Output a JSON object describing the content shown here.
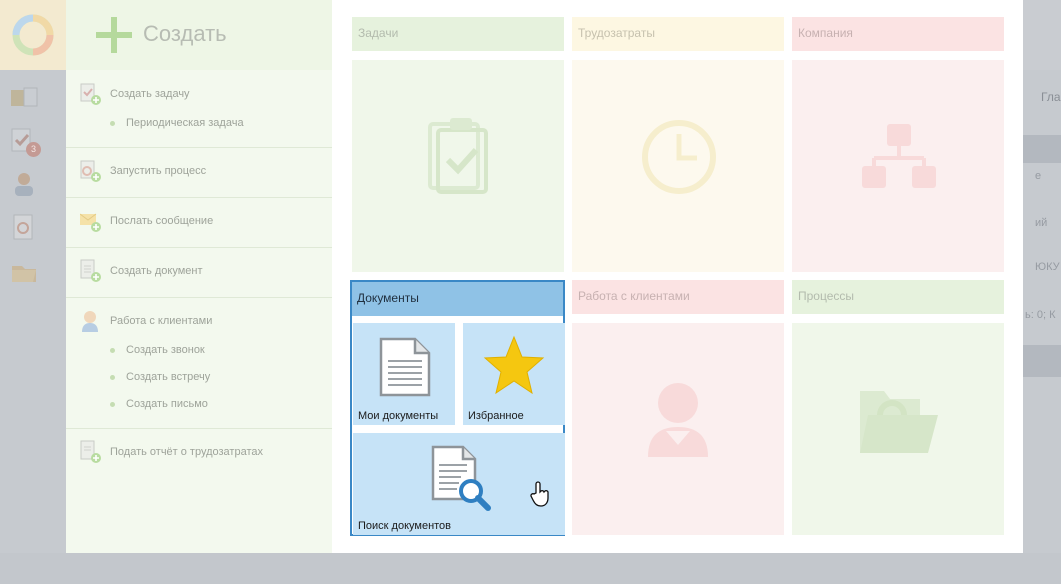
{
  "create": {
    "title": "Создать",
    "items": [
      {
        "label": "Создать задачу",
        "icon": "task-add-icon",
        "subitems": [
          {
            "label": "Периодическая задача"
          }
        ]
      },
      {
        "label": "Запустить процесс",
        "icon": "process-start-icon",
        "subitems": []
      },
      {
        "label": "Послать сообщение",
        "icon": "message-send-icon",
        "subitems": []
      },
      {
        "label": "Создать документ",
        "icon": "document-add-icon",
        "subitems": []
      },
      {
        "label": "Работа с клиентами",
        "icon": "client-icon",
        "subitems": [
          {
            "label": "Создать звонок"
          },
          {
            "label": "Создать встречу"
          },
          {
            "label": "Создать письмо"
          }
        ]
      },
      {
        "label": "Подать отчёт о трудозатратах",
        "icon": "report-add-icon",
        "subitems": []
      }
    ]
  },
  "groups": {
    "tasks": {
      "label": "Задачи",
      "icon": "clipboard-check-icon"
    },
    "labor": {
      "label": "Трудозатраты",
      "icon": "clock-icon"
    },
    "company": {
      "label": "Компания",
      "icon": "org-chart-icon"
    },
    "documents": {
      "label": "Документы",
      "tiles": [
        {
          "label": "Мои документы",
          "icon": "document-icon"
        },
        {
          "label": "Избранное",
          "icon": "star-icon"
        },
        {
          "label": "Поиск документов",
          "icon": "document-search-icon"
        }
      ]
    },
    "clients": {
      "label": "Работа с клиентами",
      "icon": "client-person-icon"
    },
    "processes": {
      "label": "Процессы",
      "icon": "folder-process-icon"
    }
  },
  "background": {
    "badge_count": "3",
    "right_tab": "Гла",
    "right_texts": [
      "е",
      "ий",
      "ЮКУ",
      "ь: 0; К"
    ]
  },
  "colors": {
    "accent": "#3a88c6",
    "tasks": "#e6f2dd",
    "labor": "#fdf7e2",
    "company": "#fbe3e3",
    "documents": "#8fc2e6",
    "clients": "#fbe3e3",
    "processes": "#e6f2dd"
  }
}
